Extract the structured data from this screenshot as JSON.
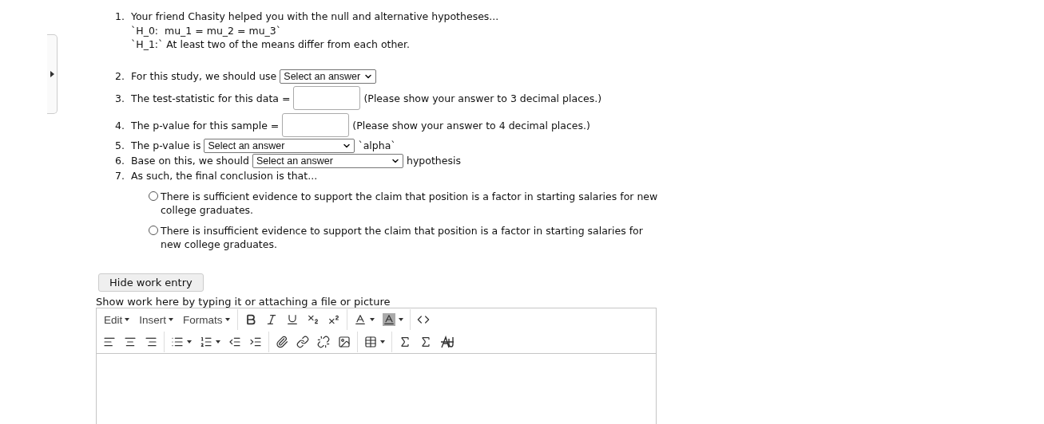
{
  "questions": [
    {
      "number": "1.",
      "kind": "text",
      "text": "Your friend Chasity helped you with the null and alternative hypotheses...",
      "lines": [
        "`H_0:  mu_1 = mu_2 = mu_3`",
        "`H_1:` At least two of the means differ from each other."
      ]
    },
    {
      "number": "2.",
      "kind": "select",
      "before": "For this study, we should use",
      "value": "Select an answer"
    },
    {
      "number": "3.",
      "kind": "input",
      "before": "The test-statistic for this data =",
      "after": "(Please show your answer to 3 decimal places.)"
    },
    {
      "number": "4.",
      "kind": "input",
      "before": "The p-value for this sample =",
      "after": "(Please show your answer to 4 decimal places.)"
    },
    {
      "number": "5.",
      "kind": "select",
      "before": "The p-value is",
      "value": "Select an answer",
      "after": "`alpha`"
    },
    {
      "number": "6.",
      "kind": "select",
      "before": "Base on this, we should",
      "value": "Select an answer",
      "after": "hypothesis"
    },
    {
      "number": "7.",
      "kind": "text",
      "text": "As such, the final conclusion is that..."
    }
  ],
  "options": [
    {
      "label": "There is sufficient evidence to support the claim that position is a factor in starting salaries for new college graduates.",
      "selected": false
    },
    {
      "label": "There is insufficient evidence to support the claim that position is a factor in starting salaries for new college graduates.",
      "selected": false
    }
  ],
  "work": {
    "toggle_button": "Hide work entry",
    "caption": "Show work here by typing it or attaching a file or picture",
    "menus": [
      "Edit",
      "Insert",
      "Formats"
    ]
  }
}
